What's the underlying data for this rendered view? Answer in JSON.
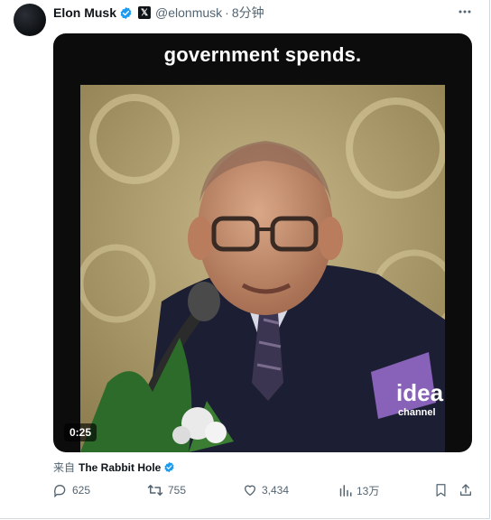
{
  "tweet": {
    "author_name": "Elon Musk",
    "handle": "@elonmusk",
    "separator": "·",
    "time": "8分钟",
    "media": {
      "caption": "government spends.",
      "duration": "0:25",
      "watermark_line1": "idea",
      "watermark_line2": "channel"
    },
    "source_prefix": "来自",
    "source_name": "The Rabbit Hole"
  },
  "actions": {
    "replies": "625",
    "reposts": "755",
    "likes": "3,434",
    "views": "13万"
  },
  "colors": {
    "text_primary": "#0f1419",
    "text_secondary": "#536471",
    "verified_blue": "#1d9bf0",
    "border": "#cfd9de"
  }
}
